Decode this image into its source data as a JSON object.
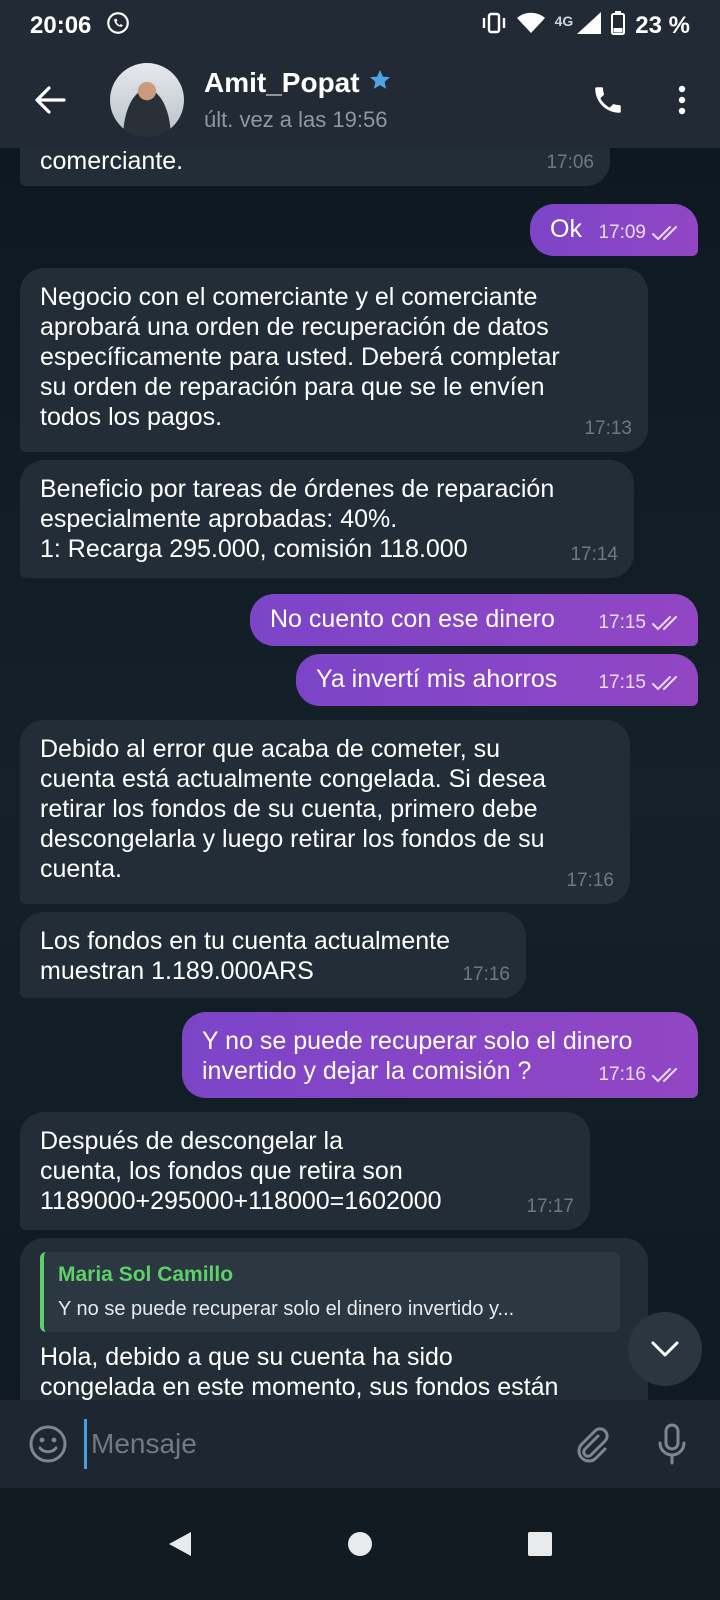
{
  "status": {
    "time": "20:06",
    "network": "4G",
    "battery": "23 %"
  },
  "header": {
    "name": "Amit_Popat",
    "last_seen": "últ. vez a las 19:56"
  },
  "messages": [
    {
      "dir": "in",
      "text": "comerciante.",
      "time": "17:06"
    },
    {
      "dir": "out",
      "text": "Ok",
      "time": "17:09"
    },
    {
      "dir": "in",
      "text": "Negocio con el comerciante y el comerciante\naprobará una orden de recuperación de datos\nespecíficamente para usted. Deberá completar\nsu orden de reparación para que se le envíen\ntodos los pagos.",
      "time": "17:13"
    },
    {
      "dir": "in",
      "text": "Beneficio por tareas de órdenes de reparación\nespecialmente aprobadas: 40%.\n1: Recarga 295.000, comisión 118.000",
      "time": "17:14"
    },
    {
      "dir": "out",
      "text": "No cuento con ese dinero",
      "time": "17:15"
    },
    {
      "dir": "out",
      "text": "Ya invertí mis ahorros",
      "time": "17:15"
    },
    {
      "dir": "in",
      "text": "Debido al error que acaba de cometer, su\ncuenta está actualmente congelada. Si desea\nretirar los fondos de su cuenta, primero debe\ndescongelarla y luego retirar los fondos de su\ncuenta.",
      "time": "17:16"
    },
    {
      "dir": "in",
      "text": "Los fondos en tu cuenta actualmente\nmuestran 1.189.000ARS",
      "time": "17:16"
    },
    {
      "dir": "out",
      "text": "Y no se puede recuperar solo el dinero\ninvertido y dejar la comisión ?",
      "time": "17:16"
    },
    {
      "dir": "in",
      "text": "Después de descongelar la\ncuenta, los fondos que retira son\n1189000+295000+118000=1602000",
      "time": "17:17"
    },
    {
      "dir": "in",
      "text": "Hola, debido a que su cuenta ha sido\ncongelada en este momento, sus fondos están",
      "time": ""
    }
  ],
  "reply": {
    "name": "Maria Sol Camillo",
    "text": "Y no se puede recuperar solo el dinero invertido y..."
  },
  "input": {
    "placeholder": "Mensaje"
  },
  "colors": {
    "outgoing_bubble": "#8a45c6",
    "incoming_bubble": "#222d37",
    "header": "#222b35",
    "verified_star": "#4fa3e6",
    "reply_accent": "#5fcf6a"
  }
}
